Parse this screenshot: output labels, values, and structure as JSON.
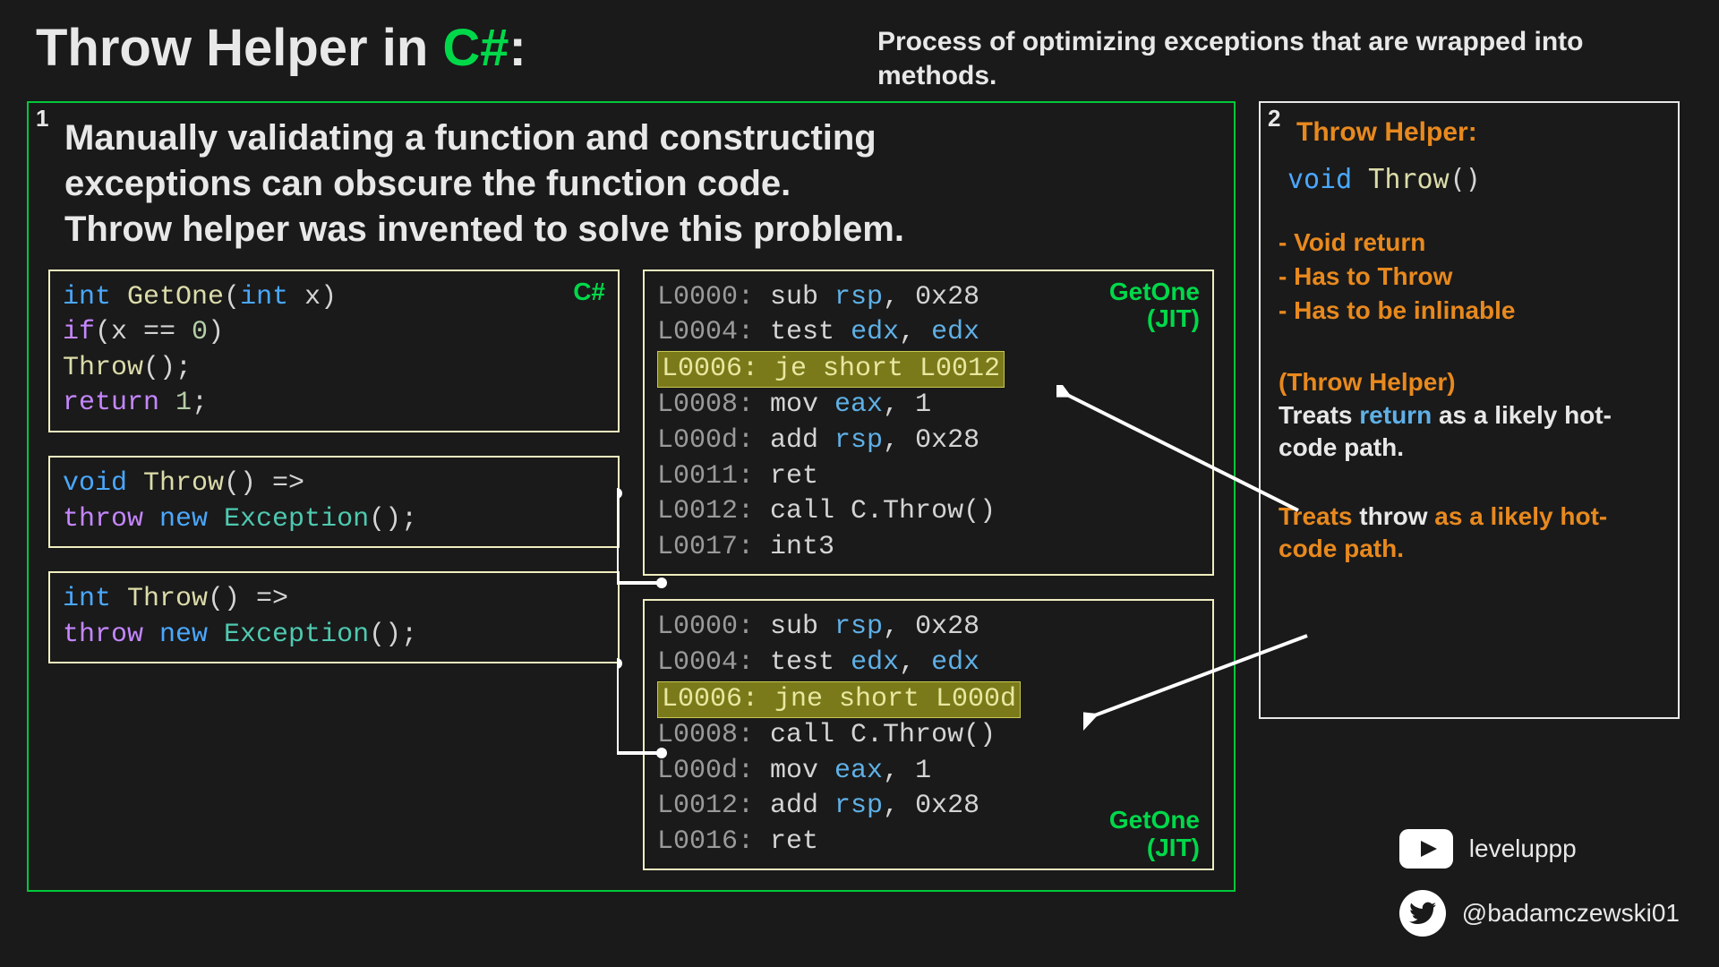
{
  "header": {
    "title_pre": "Throw Helper in ",
    "title_green": "C#",
    "title_post": ":",
    "subtitle": "Process of optimizing exceptions that are wrapped into methods."
  },
  "panel1": {
    "num": "1",
    "intro_l1": "Manually validating a function and constructing",
    "intro_l2": "exceptions can obscure the function code.",
    "intro_l3": "Throw helper was invented to solve this problem.",
    "csharp_badge": "C#",
    "jit_badge1": "GetOne",
    "jit_badge2": "(JIT)",
    "code1": {
      "l1_int": "int",
      "l1_fn": " GetOne",
      "l1_p1": "(",
      "l1_int2": "int",
      "l1_p2": " x)",
      "l2_if": "    if",
      "l2_cond": "(x == ",
      "l2_zero": "0",
      "l2_close": ")",
      "l3_call": "        Throw",
      "l3_p": "();",
      "l4_ret": "    return ",
      "l4_one": "1",
      "l4_semi": ";"
    },
    "code2": {
      "l1_void": "void",
      "l1_fn": " Throw",
      "l1_rest": "() =>",
      "l2_throw": "  throw ",
      "l2_new": "new ",
      "l2_exc": "Exception",
      "l2_p": "();"
    },
    "code3": {
      "l1_int": "int",
      "l1_fn": " Throw",
      "l1_rest": "() =>",
      "l2_throw": "  throw ",
      "l2_new": "new ",
      "l2_exc": "Exception",
      "l2_p": "();"
    },
    "asm1": {
      "l1": {
        "lbl": "L0000:",
        "i": " sub ",
        "r": "rsp",
        "t": ", 0x28"
      },
      "l2": {
        "lbl": "L0004:",
        "i": " test ",
        "r": "edx",
        "t": ", ",
        "r2": "edx"
      },
      "l3": {
        "full": "L0006: je short L0012"
      },
      "l4": {
        "lbl": "L0008:",
        "i": " mov ",
        "r": "eax",
        "t": ", 1"
      },
      "l5": {
        "lbl": "L000d:",
        "i": " add ",
        "r": "rsp",
        "t": ", 0x28"
      },
      "l6": {
        "lbl": "L0011:",
        "i": " ret"
      },
      "l7": {
        "lbl": "L0012:",
        "i": " call C.Throw()"
      },
      "l8": {
        "lbl": "L0017:",
        "i": " int3"
      }
    },
    "asm2": {
      "l1": {
        "lbl": "L0000:",
        "i": " sub ",
        "r": "rsp",
        "t": ", 0x28"
      },
      "l2": {
        "lbl": "L0004:",
        "i": " test ",
        "r": "edx",
        "t": ", ",
        "r2": "edx"
      },
      "l3": {
        "full": "L0006: jne short L000d"
      },
      "l4": {
        "lbl": "L0008:",
        "i": " call C.Throw()"
      },
      "l5": {
        "lbl": "L000d:",
        "i": " mov ",
        "r": "eax",
        "t": ", 1"
      },
      "l6": {
        "lbl": "L0012:",
        "i": " add ",
        "r": "rsp",
        "t": ", 0x28"
      },
      "l7": {
        "lbl": "L0016:",
        "i": " ret"
      }
    }
  },
  "panel2": {
    "num": "2",
    "heading": "Throw Helper:",
    "code_void": "void",
    "code_fn": " Throw",
    "code_p": "()",
    "bullet1": "- Void return",
    "bullet2": "- Has to Throw",
    "bullet3": "- Has to be inlinable",
    "p1a": "(Throw Helper)",
    "p1b_pre": "Treats ",
    "p1b_word": "return",
    "p1b_post": " as a likely hot-code path.",
    "p2_pre": "Treats ",
    "p2_word": "throw",
    "p2_post": " as a likely hot-code path."
  },
  "socials": {
    "youtube": "leveluppp",
    "twitter": "@badamczewski01"
  }
}
